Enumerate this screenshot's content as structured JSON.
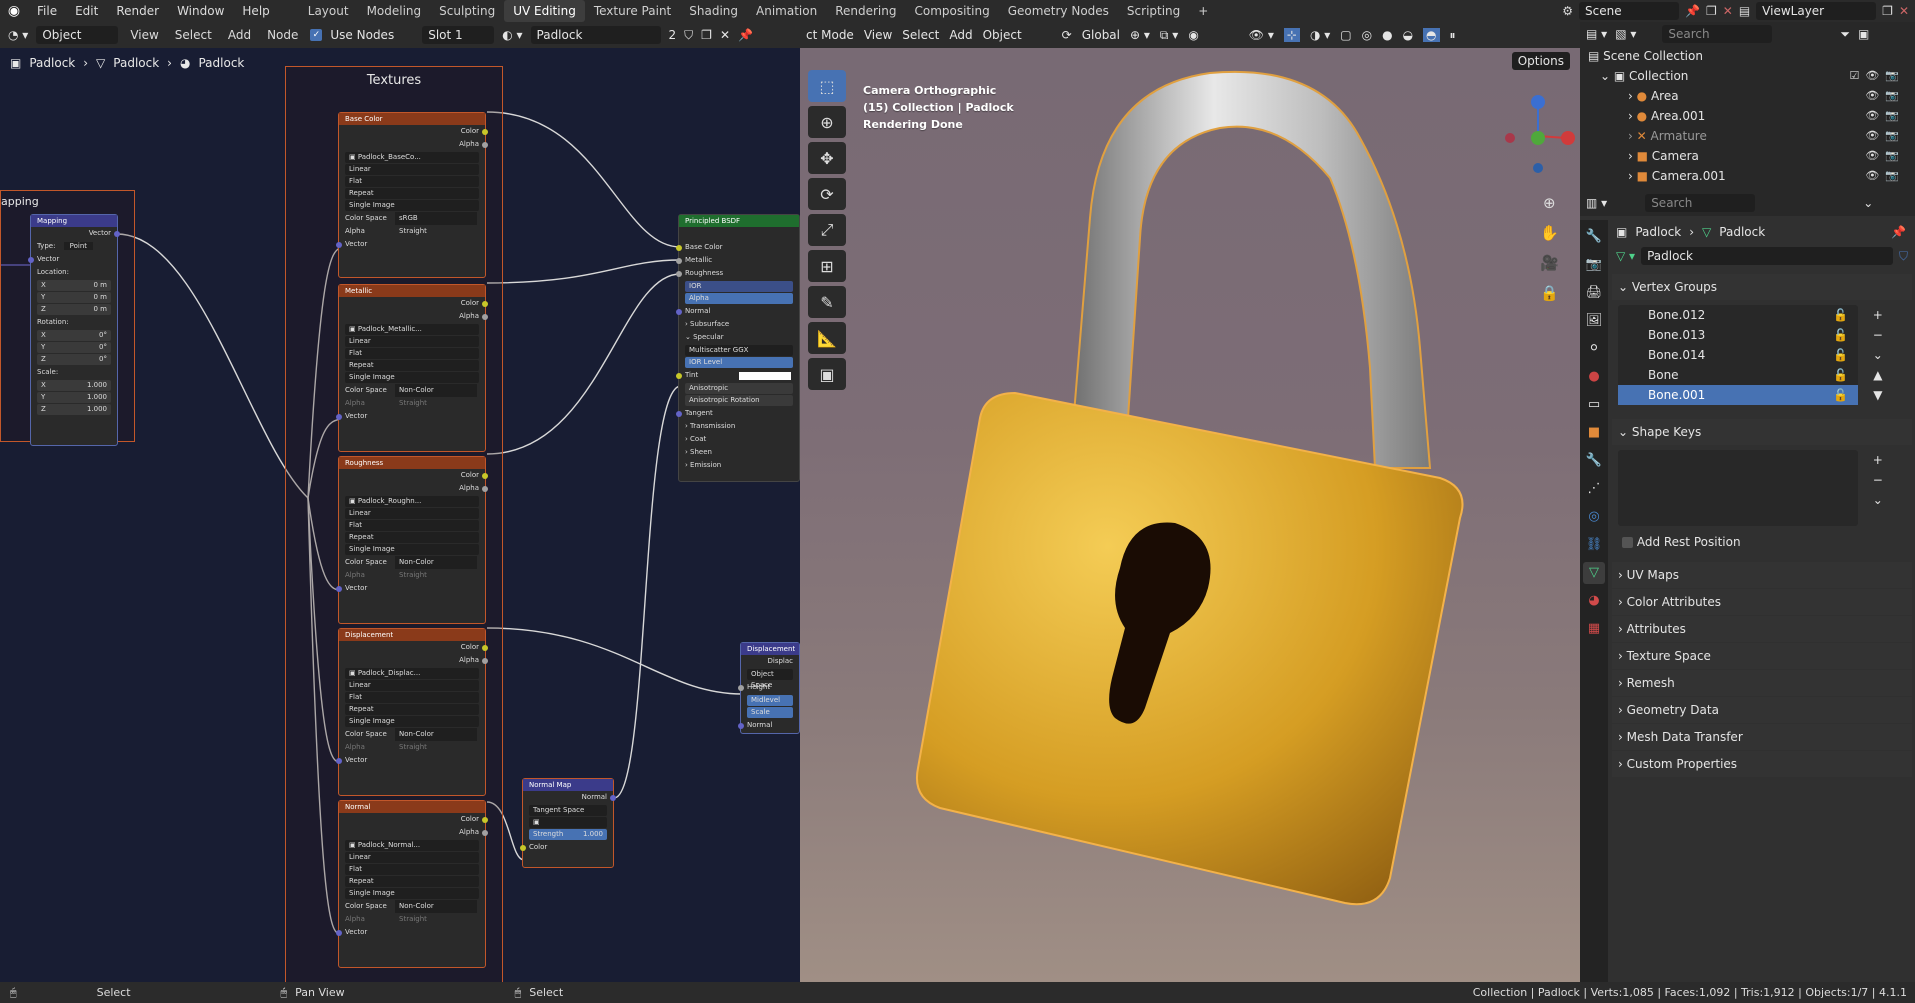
{
  "topbar": {
    "menus": [
      "File",
      "Edit",
      "Render",
      "Window",
      "Help"
    ],
    "workspaces": [
      "Layout",
      "Modeling",
      "Sculpting",
      "UV Editing",
      "Texture Paint",
      "Shading",
      "Animation",
      "Rendering",
      "Compositing",
      "Geometry Nodes",
      "Scripting"
    ],
    "active_workspace": "UV Editing",
    "add_tab": "+",
    "scene": "Scene",
    "view_layer": "ViewLayer"
  },
  "node_editor": {
    "mode": "Object",
    "menus": [
      "View",
      "Select",
      "Add",
      "Node"
    ],
    "use_nodes_label": "Use Nodes",
    "slot": "Slot 1",
    "material": "Padlock",
    "users": "2",
    "breadcrumb": [
      "Padlock",
      "Padlock",
      "Padlock"
    ],
    "frames": {
      "textures": "Textures",
      "mapping": "apping"
    },
    "mapping_node": {
      "title": "Mapping",
      "out_vector": "Vector",
      "type_label": "Type:",
      "type_value": "Point",
      "in_vector": "Vector",
      "location_label": "Location:",
      "location": [
        "X",
        "0 m",
        "Y",
        "0 m",
        "Z",
        "0 m"
      ],
      "rotation_label": "Rotation:",
      "rotation": [
        "X",
        "0°",
        "Y",
        "0°",
        "Z",
        "0°"
      ],
      "scale_label": "Scale:",
      "scale": [
        "X",
        "1.000",
        "Y",
        "1.000",
        "Z",
        "1.000"
      ]
    },
    "texture_nodes": [
      {
        "title": "Base Color",
        "image": "Padlock_BaseCo...",
        "color_space": "sRGB",
        "alpha": "Straight"
      },
      {
        "title": "Metallic",
        "image": "Padlock_Metallic...",
        "color_space": "Non-Color",
        "alpha": "Straight"
      },
      {
        "title": "Roughness",
        "image": "Padlock_Roughn...",
        "color_space": "Non-Color",
        "alpha": "Straight"
      },
      {
        "title": "Displacement",
        "image": "Padlock_Displac...",
        "color_space": "Non-Color",
        "alpha": "Straight"
      },
      {
        "title": "Normal",
        "image": "Padlock_Normal...",
        "color_space": "Non-Color",
        "alpha": "Straight"
      }
    ],
    "tex_common": {
      "out_color": "Color",
      "out_alpha": "Alpha",
      "interp": "Linear",
      "proj": "Flat",
      "ext": "Repeat",
      "src": "Single Image",
      "color_space_label": "Color Space",
      "alpha_label": "Alpha",
      "in_vector": "Vector"
    },
    "bsdf": {
      "title": "Principled BSDF",
      "inputs": [
        "Base Color",
        "Metallic",
        "Roughness",
        "IOR",
        "Alpha",
        "Normal",
        "Subsurface",
        "Specular",
        "Multiscatter GGX",
        "IOR Level",
        "Tint",
        "Anisotropic",
        "Anisotropic Rotation",
        "Tangent",
        "Transmission",
        "Coat",
        "Sheen",
        "Emission"
      ]
    },
    "normal_map": {
      "title": "Normal Map",
      "out": "Normal",
      "space": "Tangent Space",
      "strength_label": "Strength",
      "strength": "1.000",
      "in_color": "Color"
    },
    "displacement": {
      "title": "Displacement",
      "out": "Displac",
      "space": "Object Space",
      "height": "Height",
      "midlevel": "Midlevel",
      "scale": "Scale",
      "normal": "Normal"
    }
  },
  "viewport": {
    "mode": "ct Mode",
    "menus": [
      "View",
      "Select",
      "Add",
      "Object"
    ],
    "orientation": "Global",
    "info_lines": [
      "Camera Orthographic",
      "(15) Collection | Padlock",
      "Rendering Done"
    ],
    "options": "Options"
  },
  "outliner": {
    "search_placeholder": "Search",
    "scene_collection": "Scene Collection",
    "collection": "Collection",
    "items": [
      "Area",
      "Area.001",
      "Armature",
      "Camera",
      "Camera.001"
    ]
  },
  "properties": {
    "search_placeholder": "Search",
    "breadcrumb": [
      "Padlock",
      "Padlock"
    ],
    "mesh_name": "Padlock",
    "vertex_groups_title": "Vertex Groups",
    "vertex_groups": [
      "Bone.012",
      "Bone.013",
      "Bone.014",
      "Bone",
      "Bone.001"
    ],
    "selected_group": "Bone.001",
    "shape_keys_title": "Shape Keys",
    "add_rest_position": "Add Rest Position",
    "panels": [
      "UV Maps",
      "Color Attributes",
      "Attributes",
      "Texture Space",
      "Remesh",
      "Geometry Data",
      "Mesh Data Transfer",
      "Custom Properties"
    ]
  },
  "statusbar": {
    "hints": [
      "Select",
      "Pan View",
      "Select"
    ],
    "stats": "Collection | Padlock | Verts:1,085 | Faces:1,092 | Tris:1,912 | Objects:1/7 | 4.1.1"
  },
  "colors": {
    "accent": "#4772b3",
    "frame_border": "#c2572a",
    "node_bg": "#181d33",
    "padlock_gold": "#d8a32c"
  }
}
